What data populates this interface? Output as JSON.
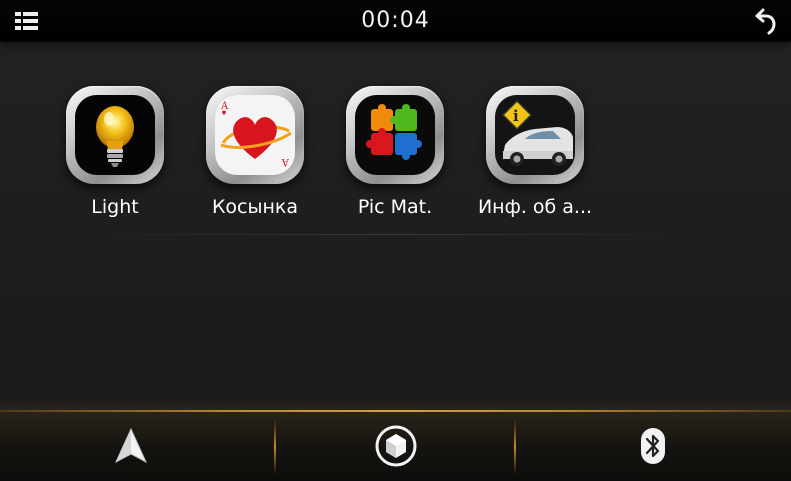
{
  "status_bar": {
    "time": "00:04",
    "menu_icon": "grid-menu-icon",
    "back_icon": "back-arrow-icon"
  },
  "apps": [
    {
      "label": "Light",
      "icon": "light-bulb-icon"
    },
    {
      "label": "Косынка",
      "icon": "heart-card-icon"
    },
    {
      "label": "Pic Mat.",
      "icon": "puzzle-icon"
    },
    {
      "label": "Инф. об а...",
      "icon": "car-info-icon"
    }
  ],
  "dock": {
    "items": [
      {
        "icon": "navigation-arrow-icon"
      },
      {
        "icon": "home-hexagon-icon"
      },
      {
        "icon": "bluetooth-icon"
      }
    ]
  },
  "colors": {
    "background": "#1e1e1e",
    "top_bar": "#000000",
    "dock_accent": "#dca03c",
    "text": "#ffffff"
  }
}
